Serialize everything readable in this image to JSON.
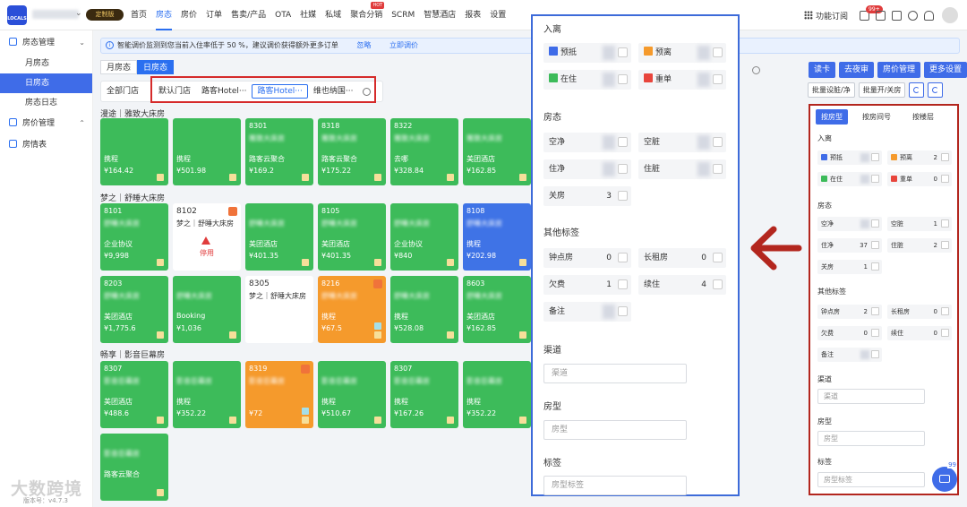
{
  "header": {
    "logo_text": "LOCALS",
    "vip_label": "定制版",
    "nav": [
      {
        "label": "首页",
        "active": false
      },
      {
        "label": "房态",
        "active": true
      },
      {
        "label": "房价",
        "active": false
      },
      {
        "label": "订单",
        "active": false
      },
      {
        "label": "售卖/产品",
        "active": false
      },
      {
        "label": "OTA",
        "active": false
      },
      {
        "label": "社媒",
        "active": false
      },
      {
        "label": "私域",
        "active": false
      },
      {
        "label": "聚合分销",
        "active": false,
        "badge": "HOT"
      },
      {
        "label": "SCRM",
        "active": false
      },
      {
        "label": "智慧酒店",
        "active": false
      },
      {
        "label": "报表",
        "active": false
      },
      {
        "label": "设置",
        "active": false
      }
    ],
    "func_label": "功能订阅",
    "notif_badge": "99+"
  },
  "sidebar": {
    "group1": "房态管理",
    "items": [
      "月房态",
      "日房态",
      "房态日志"
    ],
    "group2": "房价管理",
    "group3": "房情表",
    "version": "版本号：v4.7.3",
    "watermark": "大数跨境"
  },
  "notice": {
    "text": "智能调价监测到您当前入住率低于 50 %，建议调价获得额外更多订单",
    "ignore": "忽略",
    "adjust": "立即调价"
  },
  "view_tabs": [
    "月房态",
    "日房态"
  ],
  "store_tabs": [
    "全部门店",
    "默认门店",
    "路客Hotel···",
    "路客Hotel···",
    "维也纳国···"
  ],
  "toolbar": {
    "b1": "读卡",
    "b2": "去夜审",
    "b3": "房价管理",
    "b4": "更多设置"
  },
  "toolbar2": {
    "b1": "批量设脏/净",
    "b2": "批量开/关房"
  },
  "floors": [
    {
      "label": "漫途｜雅致大床房"
    },
    {
      "label": "梦之｜舒睡大床房"
    },
    {
      "label": "畅享｜影音巨幕房"
    }
  ],
  "rooms": [
    {
      "c": "g",
      "num": "",
      "type": "",
      "channel": "携程",
      "price": "¥164.42"
    },
    {
      "c": "g",
      "num": "",
      "type": "",
      "channel": "携程",
      "price": "¥501.98"
    },
    {
      "c": "g",
      "num": "8301",
      "type": "雅致大床房",
      "channel": "路客云聚合",
      "price": "¥169.2"
    },
    {
      "c": "g",
      "num": "8318",
      "type": "雅致大床房",
      "channel": "路客云聚合",
      "price": "¥175.22"
    },
    {
      "c": "g",
      "num": "8322",
      "type": "雅致大床房",
      "channel": "去哪",
      "price": "¥328.84"
    },
    {
      "c": "g",
      "num": "",
      "type": "雅致大床房",
      "channel": "美团酒店",
      "price": "¥162.85"
    },
    {
      "c": "g",
      "num": "8101",
      "type": "舒睡大床房",
      "channel": "企业协议",
      "price": "¥9,998"
    },
    {
      "c": "w",
      "num": "8102",
      "type": "梦之｜舒睡大床房",
      "channel": "停用",
      "price": ""
    },
    {
      "c": "g",
      "num": "",
      "type": "舒睡大床房",
      "channel": "美团酒店",
      "price": "¥401.35"
    },
    {
      "c": "g",
      "num": "8105",
      "type": "舒睡大床房",
      "channel": "美团酒店",
      "price": "¥401.35"
    },
    {
      "c": "g",
      "num": "",
      "type": "舒睡大床房",
      "channel": "企业协议",
      "price": "¥840"
    },
    {
      "c": "b",
      "num": "8108",
      "type": "舒睡大床房",
      "channel": "携程",
      "price": "¥202.98"
    },
    {
      "c": "g",
      "num": "8203",
      "type": "舒睡大床房",
      "channel": "美团酒店",
      "price": "¥1,775.6"
    },
    {
      "c": "g",
      "num": "",
      "type": "舒睡大床房",
      "channel": "Booking",
      "price": "¥1,036"
    },
    {
      "c": "w",
      "num": "8305",
      "type": "梦之｜舒睡大床房",
      "channel": "",
      "price": ""
    },
    {
      "c": "o",
      "num": "8216",
      "type": "舒睡大床房",
      "channel": "携程",
      "price": "¥67.5"
    },
    {
      "c": "g",
      "num": "",
      "type": "舒睡大床房",
      "channel": "携程",
      "price": "¥528.08"
    },
    {
      "c": "g",
      "num": "8603",
      "type": "舒睡大床房",
      "channel": "美团酒店",
      "price": "¥162.85"
    },
    {
      "c": "g",
      "num": "8307",
      "type": "影音巨幕房",
      "channel": "美团酒店",
      "price": "¥488.6"
    },
    {
      "c": "g",
      "num": "",
      "type": "影音巨幕房",
      "channel": "携程",
      "price": "¥352.22"
    },
    {
      "c": "o",
      "num": "8319",
      "type": "影音巨幕房",
      "channel": "",
      "price": "¥72"
    },
    {
      "c": "g",
      "num": "",
      "type": "影音巨幕房",
      "channel": "携程",
      "price": "¥510.67"
    },
    {
      "c": "g",
      "num": "8307",
      "type": "影音巨幕房",
      "channel": "携程",
      "price": "¥167.26"
    },
    {
      "c": "g",
      "num": "",
      "type": "影音巨幕房",
      "channel": "携程",
      "price": "¥352.22"
    },
    {
      "c": "g",
      "num": "",
      "type": "影音巨幕房",
      "channel": "路客云聚合",
      "price": ""
    }
  ],
  "popup": {
    "sec_arrive": "入离",
    "arrive": [
      {
        "label": "预抵",
        "color": "#3f6ce8",
        "count": ""
      },
      {
        "label": "预离",
        "color": "#f59a2c",
        "count": ""
      },
      {
        "label": "在住",
        "color": "#3dbb5a",
        "count": ""
      },
      {
        "label": "重单",
        "color": "#e8453c",
        "count": ""
      }
    ],
    "sec_status": "房态",
    "status": [
      {
        "label": "空净",
        "count": ""
      },
      {
        "label": "空脏",
        "count": ""
      },
      {
        "label": "住净",
        "count": ""
      },
      {
        "label": "住脏",
        "count": ""
      },
      {
        "label": "关房",
        "count": "3"
      }
    ],
    "sec_other": "其他标签",
    "other": [
      {
        "label": "钟点房",
        "count": "0"
      },
      {
        "label": "长租房",
        "count": "0"
      },
      {
        "label": "欠费",
        "count": "1"
      },
      {
        "label": "续住",
        "count": "4"
      },
      {
        "label": "备注",
        "count": ""
      }
    ],
    "sec_channel": "渠道",
    "channel_ph": "渠道",
    "sec_roomtype": "房型",
    "roomtype_ph": "房型",
    "sec_tag": "标签",
    "tag_ph": "房型标签"
  },
  "panel": {
    "tabs": [
      "按房型",
      "按房间号",
      "按楼层"
    ],
    "sec_arrive": "入离",
    "arrive": [
      {
        "label": "预抵",
        "color": "#3f6ce8",
        "count": ""
      },
      {
        "label": "预离",
        "color": "#f59a2c",
        "count": "2"
      },
      {
        "label": "在住",
        "color": "#3dbb5a",
        "count": ""
      },
      {
        "label": "重单",
        "color": "#e8453c",
        "count": "0"
      }
    ],
    "sec_status": "房态",
    "status": [
      {
        "label": "空净",
        "count": ""
      },
      {
        "label": "空脏",
        "count": "1"
      },
      {
        "label": "住净",
        "count": "37"
      },
      {
        "label": "住脏",
        "count": "2"
      },
      {
        "label": "关房",
        "count": "1"
      }
    ],
    "sec_other": "其他标签",
    "other": [
      {
        "label": "钟点房",
        "count": "2"
      },
      {
        "label": "长租房",
        "count": "0"
      },
      {
        "label": "欠费",
        "count": "0"
      },
      {
        "label": "续住",
        "count": "0"
      },
      {
        "label": "备注",
        "count": ""
      }
    ],
    "sec_channel": "渠道",
    "channel_ph": "渠道",
    "sec_roomtype": "房型",
    "roomtype_ph": "房型",
    "sec_tag": "标签",
    "tag_ph": "房型标签"
  },
  "chat_badge": "99"
}
